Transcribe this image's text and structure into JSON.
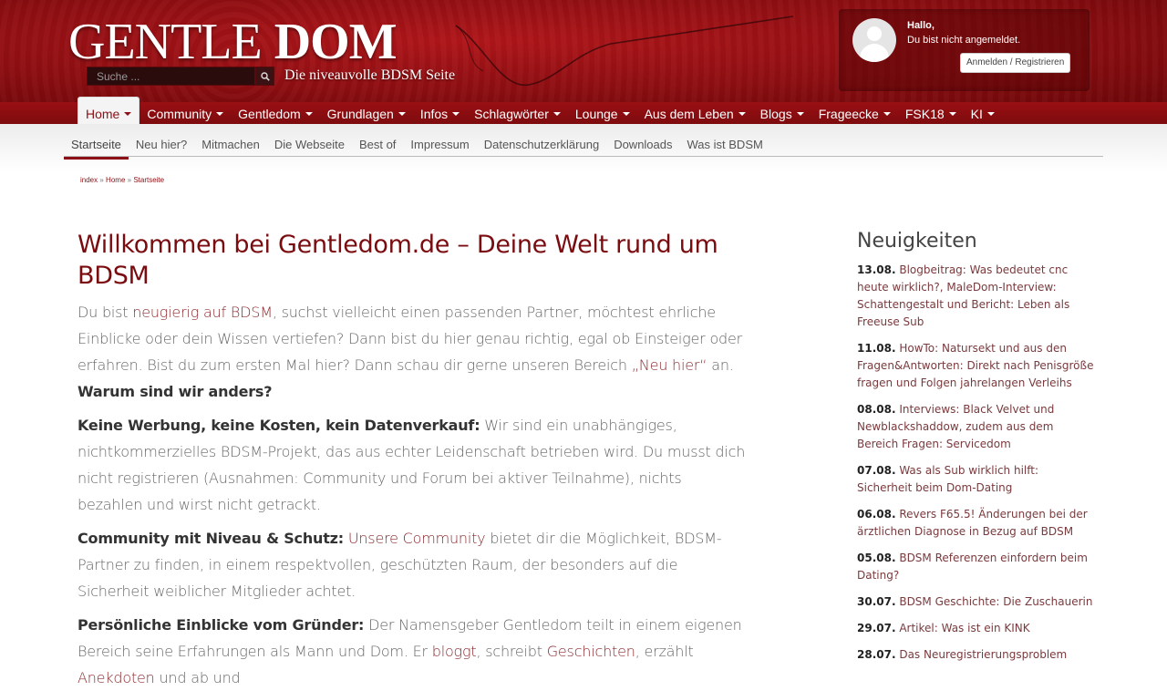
{
  "header": {
    "logo_part1": "GENTLE",
    "logo_part2": "DOM",
    "tagline": "Die niveauvolle BDSM Seite",
    "search_placeholder": "Suche ...",
    "search_icon": "magnifier-icon"
  },
  "user": {
    "hello": "Hallo,",
    "status": "Du bist nicht angemeldet.",
    "login_label": "Anmelden / Registrieren"
  },
  "main_nav": [
    {
      "label": "Home"
    },
    {
      "label": "Community"
    },
    {
      "label": "Gentledom"
    },
    {
      "label": "Grundlagen"
    },
    {
      "label": "Infos"
    },
    {
      "label": "Schlagwörter"
    },
    {
      "label": "Lounge"
    },
    {
      "label": "Aus dem Leben"
    },
    {
      "label": "Blogs"
    },
    {
      "label": "Frageecke"
    },
    {
      "label": "FSK18"
    },
    {
      "label": "KI"
    }
  ],
  "sub_nav": [
    {
      "label": "Startseite"
    },
    {
      "label": "Neu hier?"
    },
    {
      "label": "Mitmachen"
    },
    {
      "label": "Die Webseite"
    },
    {
      "label": "Best of"
    },
    {
      "label": "Impressum"
    },
    {
      "label": "Datenschutzerklärung"
    },
    {
      "label": "Downloads"
    },
    {
      "label": "Was ist BDSM"
    }
  ],
  "breadcrumb": {
    "a": "index",
    "b": "Home",
    "c": "Startseite",
    "sep": "»"
  },
  "content": {
    "title": "Willkommen bei Gentledom.de – Deine Welt rund um BDSM",
    "p1_a": "Du bist ",
    "p1_link1": "neugierig auf BDSM",
    "p1_b": ", suchst vielleicht einen passenden Partner, möchtest ehrliche Einblicke oder dein Wissen vertiefen? Dann bist du hier genau richtig, egal ob Einsteiger oder erfahren. Bist du zum ersten Mal hier? Dann schau dir gerne unseren Bereich ",
    "p1_link2": "„Neu hier“",
    "p1_c": " an. ",
    "p1_bold": "Warum sind wir anders?",
    "p2_bold": "Keine Werbung, keine Kosten, kein Datenverkauf:",
    "p2_text": " Wir sind ein unabhängiges, nichtkommerzielles BDSM-Projekt, das aus echter Leidenschaft betrieben wird. Du musst dich nicht registrieren (Ausnahmen: Community und Forum bei aktiver Teilnahme), nichts bezahlen und wirst nicht getrackt.",
    "p3_bold": "Community mit Niveau & Schutz:",
    "p3_a": " ",
    "p3_link": "Unsere Community",
    "p3_b": " bietet dir die Möglichkeit, BDSM-Partner zu finden, in einem respektvollen, geschützten Raum, der besonders auf die Sicherheit weiblicher Mitglieder achtet.",
    "p4_bold": "Persönliche Einblicke vom Gründer:",
    "p4_a": " Der Namensgeber Gentledom teilt in einem eigenen Bereich seine Erfahrungen als Mann und Dom. Er ",
    "p4_link1": "bloggt",
    "p4_b": ", schreibt ",
    "p4_link2": "Geschichten",
    "p4_c": ", erzählt ",
    "p4_link3": "Anekdoten",
    "p4_d": " und ab und"
  },
  "sidebar": {
    "title": "Neuigkeiten",
    "news": [
      {
        "date": "13.08.",
        "text": " Blogbeitrag: Was bedeutet cnc heute wirklich?, MaleDom-Interview: Schattengestalt und Bericht: Leben als Freeuse Sub"
      },
      {
        "date": "11.08.",
        "text": " HowTo: Natursekt und aus den Fragen&Antworten: Direkt nach Penisgröße fragen und Folgen jahrelangen Verleihs"
      },
      {
        "date": "08.08.",
        "text": " Interviews: Black Velvet und Newblackshaddow, zudem aus dem Bereich Fragen: Servicedom"
      },
      {
        "date": "07.08.",
        "text": " Was als Sub wirklich hilft: Sicherheit beim Dom-Dating"
      },
      {
        "date": "06.08.",
        "text": " Revers F65.5! Änderungen bei der ärztlichen Diagnose in Bezug auf BDSM"
      },
      {
        "date": "05.08.",
        "text": " BDSM Referenzen einfordern beim Dating?"
      },
      {
        "date": "30.07.",
        "text": " BDSM Geschichte: Die Zuschauerin"
      },
      {
        "date": "29.07.",
        "text": " Artikel: Was ist ein KINK"
      },
      {
        "date": "28.07.",
        "text": " Das Neuregistrierungsproblem"
      }
    ]
  }
}
